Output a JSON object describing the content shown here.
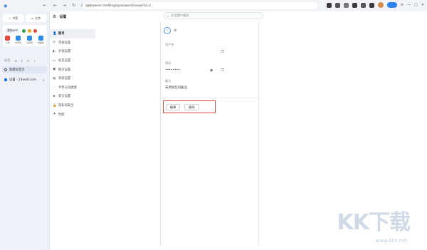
{
  "window": {
    "url": "qqbrowser://settings/passwords/view?id=2"
  },
  "left_sidebar": {
    "shortcuts": [
      {
        "label": "书签",
        "icon": "star-icon"
      },
      {
        "label": "文件",
        "icon": "folder-icon"
      }
    ],
    "card": {
      "app_pill": "我的APP",
      "apps": [
        {
          "label": "工作",
          "color": "#e8453c"
        },
        {
          "label": "中间件",
          "color": "#2b8be8"
        },
        {
          "label": "上网导",
          "color": "#2b8be8"
        },
        {
          "label": "收藏夹",
          "color": "#2b8be8"
        }
      ]
    },
    "tools_label": "标签",
    "tabs": [
      {
        "label": "新建标签页",
        "active": true
      },
      {
        "label": "设置 - 23wo8.com",
        "active": false
      }
    ]
  },
  "settings": {
    "title": "设置",
    "search_placeholder": "在设置中搜索",
    "menu": [
      {
        "label": "账号",
        "icon": "user-icon",
        "active": true
      },
      {
        "label": "常规设置",
        "icon": "sliders-icon",
        "active": false
      },
      {
        "label": "外观设置",
        "icon": "palette-icon",
        "active": false
      },
      {
        "label": "标签设置",
        "icon": "tag-icon",
        "active": false
      },
      {
        "label": "网页设置",
        "icon": "globe-icon",
        "active": false
      },
      {
        "label": "系统设置",
        "icon": "monitor-icon",
        "active": false
      },
      {
        "label": "手势与快捷键",
        "icon": "hand-icon",
        "active": false
      },
      {
        "label": "安全设置",
        "icon": "shield-icon",
        "active": false
      },
      {
        "label": "隐私和安全",
        "icon": "lock-icon",
        "active": false
      },
      {
        "label": "性能",
        "icon": "gauge-icon",
        "active": false
      }
    ]
  },
  "password_detail": {
    "username_label": "用户名",
    "username_value": "",
    "password_label": "密码",
    "password_value": "••••••••",
    "note_label": "备注",
    "note_value": "未添加任何备注",
    "edit_button": "编辑",
    "delete_button": "删除"
  },
  "watermark": {
    "brand": "KK下载",
    "url": "www.kkx.net"
  }
}
